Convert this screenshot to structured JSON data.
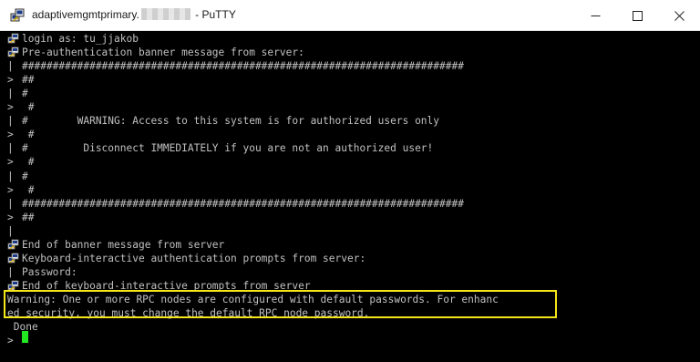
{
  "window": {
    "title_host": "adaptivemgmtprimary.",
    "title_suffix": " - PuTTY",
    "minimize_glyph": "—",
    "close_glyph": "✕"
  },
  "terminal": {
    "lines": [
      {
        "prefix": "key",
        "text": "login as: tu_jjakob"
      },
      {
        "prefix": "key",
        "text": "Pre-authentication banner message from server:"
      },
      {
        "prefix": "|",
        "text": "########################################################################"
      },
      {
        "prefix": ">",
        "text": "##"
      },
      {
        "prefix": "|",
        "text": "#"
      },
      {
        "prefix": ">",
        "text": " #"
      },
      {
        "prefix": "|",
        "text": "#        WARNING: Access to this system is for authorized users only"
      },
      {
        "prefix": ">",
        "text": " #"
      },
      {
        "prefix": "|",
        "text": "#         Disconnect IMMEDIATELY if you are not an authorized user!"
      },
      {
        "prefix": ">",
        "text": " #"
      },
      {
        "prefix": "|",
        "text": "#"
      },
      {
        "prefix": ">",
        "text": " #"
      },
      {
        "prefix": "|",
        "text": "########################################################################"
      },
      {
        "prefix": ">",
        "text": "##"
      },
      {
        "prefix": "|",
        "text": ""
      },
      {
        "prefix": "key",
        "text": "End of banner message from server"
      },
      {
        "prefix": "key",
        "text": "Keyboard-interactive authentication prompts from server:"
      },
      {
        "prefix": "|",
        "text": "Password:"
      },
      {
        "prefix": "key",
        "text": "End of keyboard-interactive prompts from server"
      },
      {
        "prefix": "",
        "text": "Warning: One or more RPC nodes are configured with default passwords. For enhanc"
      },
      {
        "prefix": "",
        "text": "ed security, you must change the default RPC node password."
      },
      {
        "prefix": "",
        "text": " Done"
      },
      {
        "prefix": ">",
        "text": ""
      }
    ]
  },
  "colors": {
    "terminal_bg": "#000000",
    "terminal_fg": "#c0c0c0",
    "cursor": "#22e822",
    "highlight_border": "#f5e51b"
  }
}
